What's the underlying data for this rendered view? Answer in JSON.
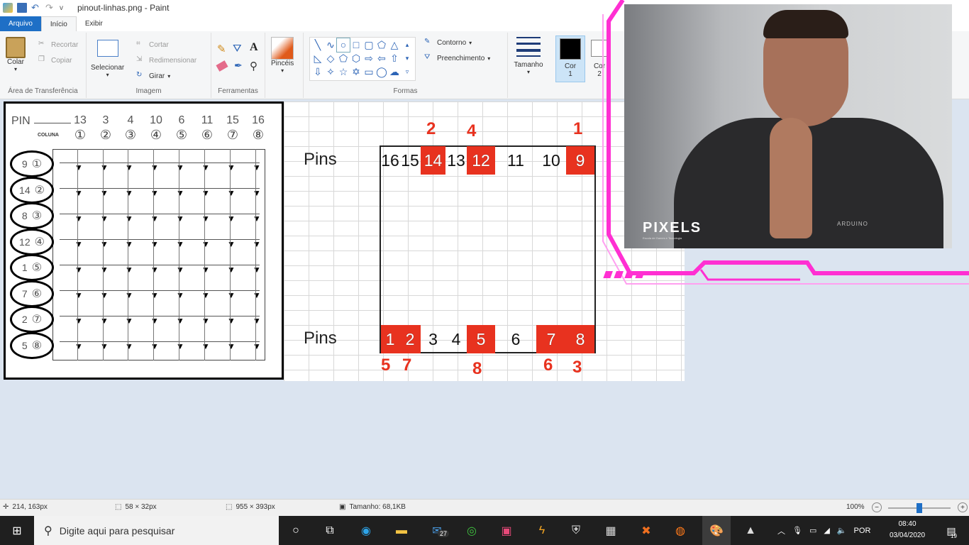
{
  "window": {
    "title": "pinout-linhas.png - Paint",
    "quick_access_arrow": "v"
  },
  "tabs": [
    {
      "label": "Arquivo"
    },
    {
      "label": "Início"
    },
    {
      "label": "Exibir"
    }
  ],
  "ribbon": {
    "clipboard": {
      "paste": "Colar",
      "cut": "Recortar",
      "copy": "Copiar",
      "group": "Área de Transferência"
    },
    "image": {
      "select": "Selecionar",
      "crop": "Cortar",
      "resize": "Redimensionar",
      "rotate": "Girar",
      "group": "Imagem"
    },
    "tools": {
      "group": "Ferramentas",
      "text_tool": "A"
    },
    "brushes": {
      "label": "Pincéis"
    },
    "shapes": {
      "outline": "Contorno",
      "fill": "Preenchimento",
      "group": "Formas"
    },
    "size": {
      "label": "Tamanho"
    },
    "color1": {
      "label": "Cor",
      "sub": "1"
    },
    "color2": {
      "label": "Cor",
      "sub": "2"
    }
  },
  "image_left": {
    "pin_label": "PIN",
    "column_label": "COLUNA",
    "top_pins": [
      "13",
      "3",
      "4",
      "10",
      "6",
      "11",
      "15",
      "16"
    ],
    "col_numbers": [
      "①",
      "②",
      "③",
      "④",
      "⑤",
      "⑥",
      "⑦",
      "⑧"
    ],
    "row_pins": [
      "9",
      "14",
      "8",
      "12",
      "1",
      "7",
      "2",
      "5"
    ],
    "row_numbers": [
      "①",
      "②",
      "③",
      "④",
      "⑤",
      "⑥",
      "⑦",
      "⑧"
    ]
  },
  "image_right": {
    "top_label": "Pins",
    "bottom_label": "Pins",
    "top_red_numbers": [
      "2",
      "4",
      "1"
    ],
    "top_row": [
      {
        "v": "16",
        "red": false
      },
      {
        "v": "15",
        "red": false
      },
      {
        "v": "14",
        "red": true
      },
      {
        "v": "13",
        "red": false
      },
      {
        "v": "12",
        "red": true
      },
      {
        "v": "11",
        "red": false
      },
      {
        "v": "10",
        "red": false
      },
      {
        "v": "9",
        "red": true
      }
    ],
    "bottom_row": [
      {
        "v": "1",
        "red": true
      },
      {
        "v": "2",
        "red": true
      },
      {
        "v": "3",
        "red": false
      },
      {
        "v": "4",
        "red": false
      },
      {
        "v": "5",
        "red": true
      },
      {
        "v": "6",
        "red": false
      },
      {
        "v": "7",
        "red": true
      },
      {
        "v": "8",
        "red": true
      }
    ],
    "bottom_red_numbers": [
      "5",
      "7",
      "8",
      "6",
      "3"
    ]
  },
  "webcam": {
    "logo": "PIXELS",
    "logo_sub": "Escola de Games e Tecnologia",
    "shirt_text": "ARDUINO"
  },
  "statusbar": {
    "cursor": "214, 163px",
    "selection": "58 × 32px",
    "image_size": "955 × 393px",
    "file_size": "Tamanho: 68,1KB",
    "zoom": "100%",
    "zoom_level": 0.5
  },
  "taskbar": {
    "search_placeholder": "Digite aqui para pesquisar",
    "mail_badge": "27",
    "language": "POR",
    "time": "08:40",
    "date": "03/04/2020",
    "notifications": "19"
  },
  "colors": {
    "accent": "#1e6fc6",
    "red_cell": "#e8321f",
    "frame_pink": "#ff2fd2"
  }
}
